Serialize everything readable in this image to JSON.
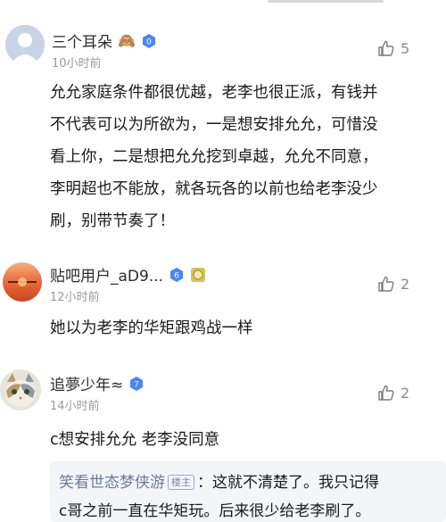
{
  "comments": [
    {
      "username": "三个耳朵",
      "emoji": "🙈",
      "level": "0",
      "time": "10小时前",
      "likes": "5",
      "lines": [
        "允允家庭条件都很优越，老李也很正派，有钱并",
        "不代表可以为所欲为，一是想安排允允，可惜没",
        "看上你，二是想把允允挖到卓越，允允不同意，",
        "李明超也不能放，就各玩各的以前也给老李没少",
        "刷，别带节奏了！"
      ]
    },
    {
      "username": "贴吧用户_aD9...",
      "level": "6",
      "time": "12小时前",
      "likes": "2",
      "lines": [
        "她以为老李的华矩跟鸡战一样"
      ]
    },
    {
      "username": "追夢少年≈",
      "level": "7",
      "time": "14小时前",
      "likes": "2",
      "lines": [
        "c想安排允允 老李没同意"
      ],
      "reply": {
        "username": "笑看世态梦侠游",
        "tag": "楼主",
        "line1": "：这就不清楚了。我只记得",
        "line2": "c哥之前一直在华矩玩。后来很少给老李刷了。"
      }
    }
  ],
  "colors": {
    "level_badge": "#4a86f5",
    "like_icon": "#7a7a7a",
    "reply_bg": "#f4f5f7"
  }
}
